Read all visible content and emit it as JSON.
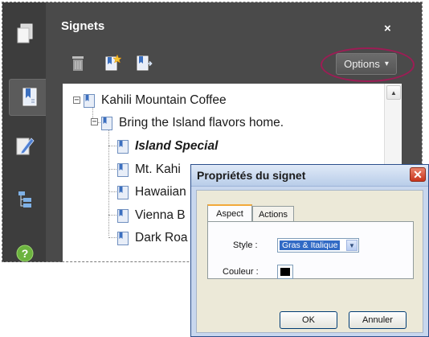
{
  "panel": {
    "title": "Signets",
    "close_glyph": "×",
    "options_label": "Options",
    "options_arrow": "▾"
  },
  "leftbar": {
    "items": [
      {
        "icon": "pages-icon"
      },
      {
        "icon": "bookmarks-icon",
        "active": true
      },
      {
        "icon": "signature-pen-icon"
      },
      {
        "icon": "layers-tree-icon"
      },
      {
        "icon": "help-icon",
        "glyph": "?"
      }
    ]
  },
  "toolbar": {
    "delete_icon": "trash-icon",
    "new_bookmark_icon": "new-bookmark-icon",
    "expand_bookmark_icon": "bookmark-arrow-icon"
  },
  "tree": {
    "items": [
      {
        "label": "Kahili Mountain Coffee",
        "expander": "−"
      },
      {
        "label": "Bring the Island flavors home.",
        "expander": "−"
      },
      {
        "label": "Island Special",
        "selected": true
      },
      {
        "label": "Mt. Kahi"
      },
      {
        "label": "Hawaiian"
      },
      {
        "label": "Vienna B"
      },
      {
        "label": "Dark Roa"
      }
    ]
  },
  "dialog": {
    "title": "Propriétés du signet",
    "close_glyph": "✕",
    "tabs": [
      "Aspect",
      "Actions"
    ],
    "style_label": "Style :",
    "style_value": "Gras & Italique",
    "style_arrow": "▼",
    "color_label": "Couleur :",
    "color_value": "#000000",
    "ok_label": "OK",
    "cancel_label": "Annuler"
  },
  "colors": {
    "panel_bg": "#4a4a4a",
    "leftbar_bg": "#3d3d3d",
    "highlight_ring": "#9c1d55",
    "dialog_title_bg": "#c8d7ee",
    "help_green": "#6cb33f"
  }
}
